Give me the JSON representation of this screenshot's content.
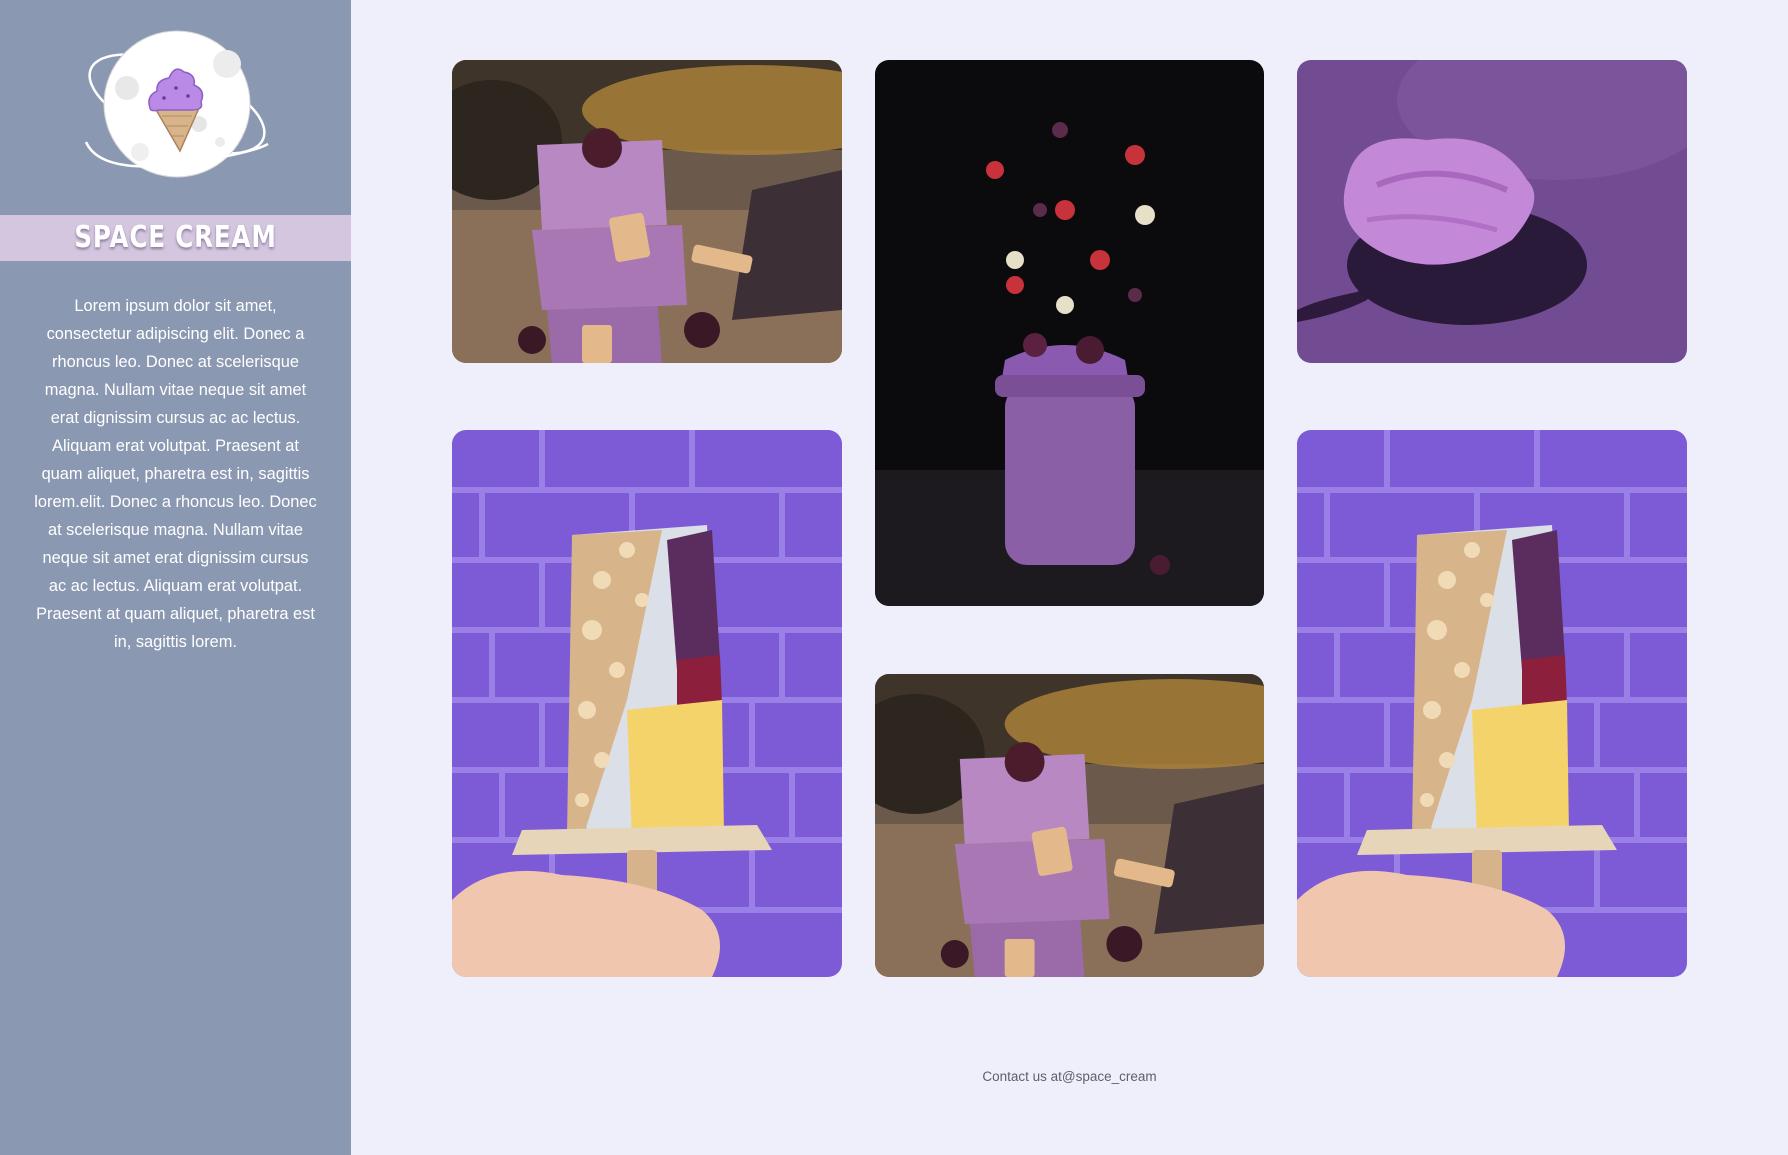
{
  "sidebar": {
    "logo_icon": "planet-ice-cream-icon",
    "brand_name": "SPACE CREAM",
    "description": "Lorem ipsum dolor sit amet, consectetur adipiscing elit. Donec a rhoncus leo. Donec at scelerisque magna. Nullam vitae neque sit amet erat dignissim cursus ac ac lectus. Aliquam erat volutpat. Praesent at quam aliquet, pharetra est in, sagittis lorem.elit. Donec a rhoncus leo. Donec at scelerisque magna. Nullam vitae neque sit amet erat dignissim cursus ac ac lectus. Aliquam erat volutpat. Praesent at quam aliquet, pharetra est in, sagittis lorem."
  },
  "gallery": {
    "photos": [
      {
        "icon": "stacked-popsicles-photo"
      },
      {
        "icon": "smoothie-jar-photo"
      },
      {
        "icon": "ice-cream-spoon-photo"
      },
      {
        "icon": "nut-popsicle-photo"
      },
      {
        "icon": "stacked-popsicles-photo"
      },
      {
        "icon": "nut-popsicle-photo"
      }
    ]
  },
  "footer": {
    "contact": "Contact us at@space_cream"
  },
  "colors": {
    "sidebar_bg": "#8b98b2",
    "brand_band": "#d3c6de",
    "page_bg": "#eeeffb",
    "accent_purple": "#7e5bd6"
  }
}
